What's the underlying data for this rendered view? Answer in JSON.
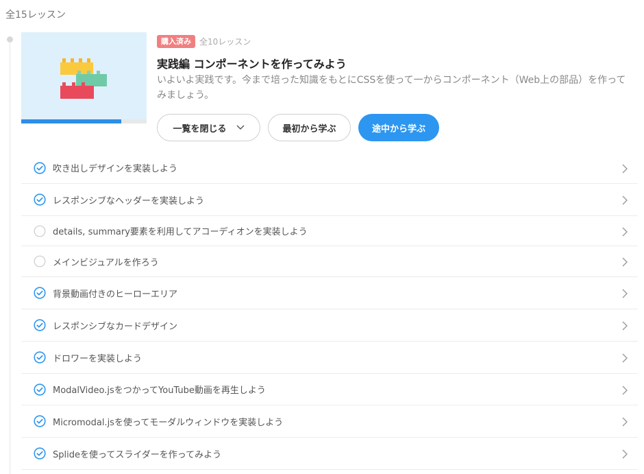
{
  "header": {
    "total_lessons": "全15レッスン"
  },
  "course": {
    "badge": "購入済み",
    "lesson_count": "全10レッスン",
    "title": "実践編 コンポーネントを作ってみよう",
    "description": "いよいよ実践です。今まで培った知識をもとにCSSを使って一からコンポーネント（Web上の部品）を作ってみましょう。",
    "progress": 0.8,
    "colors": {
      "accent": "#2d96f0",
      "badge": "#f08080",
      "thumb_bg": "#def0fb"
    }
  },
  "actions": {
    "close_list": "一覧を閉じる",
    "start_from_beginning": "最初から学ぶ",
    "resume": "途中から学ぶ"
  },
  "lessons": [
    {
      "title": "吹き出しデザインを実装しよう",
      "completed": true
    },
    {
      "title": "レスポンシブなヘッダーを実装しよう",
      "completed": true
    },
    {
      "title": "details, summary要素を利用してアコーディオンを実装しよう",
      "completed": false
    },
    {
      "title": "メインビジュアルを作ろう",
      "completed": false
    },
    {
      "title": "背景動画付きのヒーローエリア",
      "completed": true
    },
    {
      "title": "レスポンシブなカードデザイン",
      "completed": true
    },
    {
      "title": "ドロワーを実装しよう",
      "completed": true
    },
    {
      "title": "ModalVideo.jsをつかってYouTube動画を再生しよう",
      "completed": true
    },
    {
      "title": "Micromodal.jsを使ってモーダルウィンドウを実装しよう",
      "completed": true
    },
    {
      "title": "Splideを使ってスライダーを作ってみよう",
      "completed": true
    }
  ]
}
